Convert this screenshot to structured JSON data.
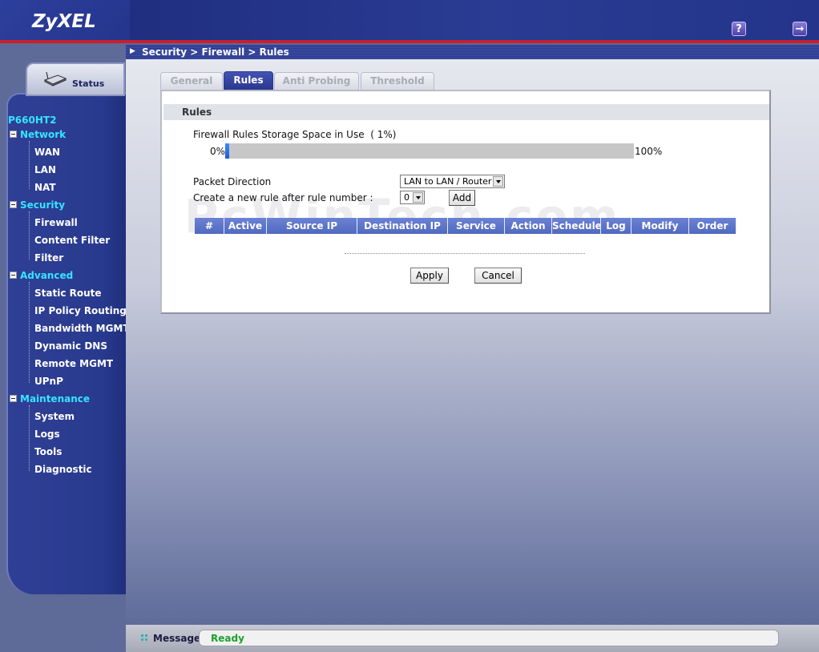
{
  "header": {
    "logo": "ZyXEL",
    "help_icon": "question-icon",
    "logout_icon": "logout-icon",
    "help_glyph": "?",
    "logout_glyph": "→"
  },
  "breadcrumb": "Security > Firewall > Rules",
  "sidebar": {
    "status_label": "Status",
    "model": "P660HT2",
    "sections": [
      {
        "label": "Network",
        "items": [
          "WAN",
          "LAN",
          "NAT"
        ]
      },
      {
        "label": "Security",
        "items": [
          "Firewall",
          "Content Filter",
          "Filter"
        ]
      },
      {
        "label": "Advanced",
        "items": [
          "Static Route",
          "IP Policy Routing",
          "Bandwidth MGMT",
          "Dynamic DNS",
          "Remote MGMT",
          "UPnP"
        ]
      },
      {
        "label": "Maintenance",
        "items": [
          "System",
          "Logs",
          "Tools",
          "Diagnostic"
        ]
      }
    ]
  },
  "tabs": [
    {
      "label": "General",
      "active": false
    },
    {
      "label": "Rules",
      "active": true
    },
    {
      "label": "Anti Probing",
      "active": false
    },
    {
      "label": "Threshold",
      "active": false
    }
  ],
  "panel": {
    "title": "Rules",
    "storage_label": "Firewall Rules Storage Space in Use",
    "storage_percent_text": "( 1%)",
    "storage_percent": 1,
    "bar_min": "0%",
    "bar_max": "100%",
    "packet_direction_label": "Packet Direction",
    "packet_direction_value": "LAN to LAN / Router",
    "new_rule_label": "Create a new rule after rule number :",
    "rule_number_value": "0",
    "add_label": "Add",
    "columns": [
      "#",
      "Active",
      "Source IP",
      "Destination IP",
      "Service",
      "Action",
      "Schedule",
      "Log",
      "Modify",
      "Order"
    ],
    "apply_label": "Apply",
    "cancel_label": "Cancel"
  },
  "watermark": "PcWinTech.com",
  "message": {
    "label": "Message",
    "text": "Ready"
  },
  "colors": {
    "accent_cyan": "#35e5ff",
    "tab_active": "#2a388f",
    "ready_green": "#1aa32a",
    "header_red": "#c8202c"
  }
}
